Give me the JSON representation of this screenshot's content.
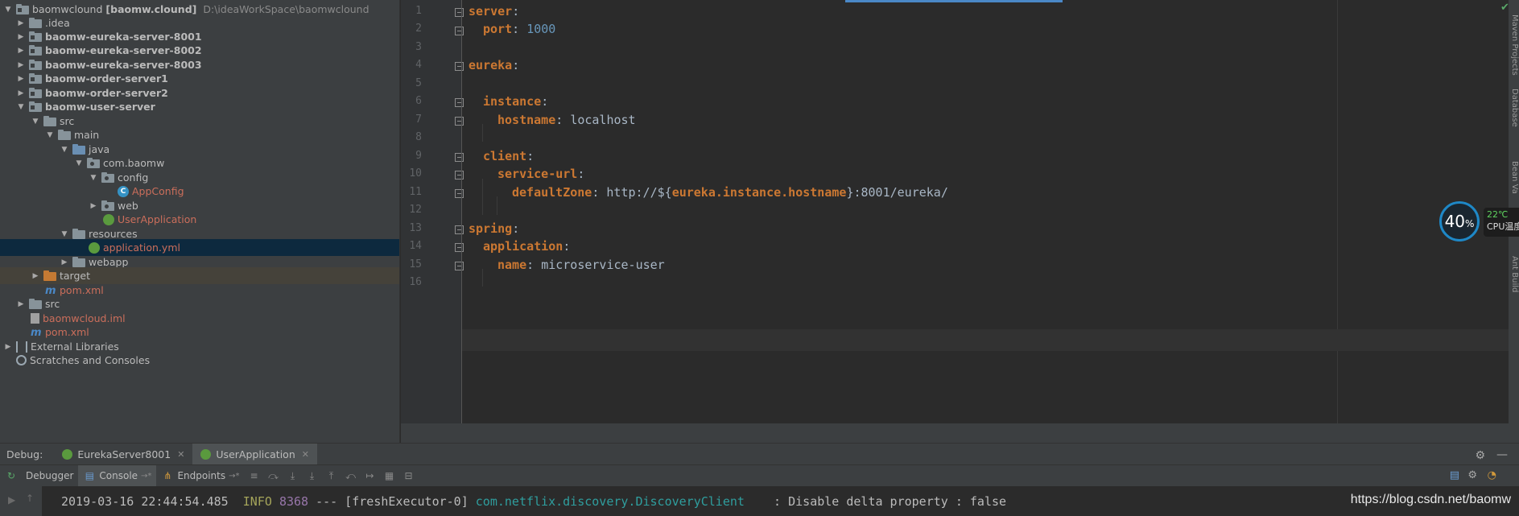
{
  "tree": {
    "root_name": "baomwclound",
    "root_module": "[baomw.clound]",
    "root_path": "D:\\ideaWorkSpace\\baomwclound",
    "items": [
      {
        "label": "baomwclound",
        "depth": 0
      },
      {
        "label": ".idea"
      },
      {
        "label": "baomw-eureka-server-8001"
      },
      {
        "label": "baomw-eureka-server-8002"
      },
      {
        "label": "baomw-eureka-server-8003"
      },
      {
        "label": "baomw-order-server1"
      },
      {
        "label": "baomw-order-server2"
      },
      {
        "label": "baomw-user-server"
      },
      {
        "label": "src"
      },
      {
        "label": "main"
      },
      {
        "label": "java"
      },
      {
        "label": "com.baomw"
      },
      {
        "label": "config"
      },
      {
        "label": "AppConfig"
      },
      {
        "label": "web"
      },
      {
        "label": "UserApplication"
      },
      {
        "label": "resources"
      },
      {
        "label": "application.yml"
      },
      {
        "label": "webapp"
      },
      {
        "label": "target"
      },
      {
        "label": "pom.xml"
      },
      {
        "label": "src"
      },
      {
        "label": "baomwcloud.iml"
      },
      {
        "label": "pom.xml"
      },
      {
        "label": "External Libraries"
      },
      {
        "label": "Scratches and Consoles"
      }
    ]
  },
  "editor": {
    "line_numbers": [
      "1",
      "2",
      "3",
      "4",
      "5",
      "6",
      "7",
      "8",
      "9",
      "10",
      "11",
      "12",
      "13",
      "14",
      "15",
      "16"
    ],
    "yaml": {
      "server": "server",
      "port_key": "port",
      "port_val": "1000",
      "eureka": "eureka",
      "instance": "instance",
      "hostname_key": "hostname",
      "hostname_val": "localhost",
      "client": "client",
      "service_url": "service-url",
      "default_zone_key": "defaultZone",
      "default_zone_prefix": "http://${",
      "default_zone_ref": "eureka.instance.hostname",
      "default_zone_suffix": "}:8001/eureka/",
      "spring": "spring",
      "application": "application",
      "name_key": "name",
      "name_val": "microservice-user",
      "colon": ":"
    }
  },
  "side_stripe": {
    "maven": "Maven Projects",
    "database": "Database",
    "bean": "Bean Va",
    "ant": "Ant Build"
  },
  "cpu": {
    "percent": "40",
    "unit": "%",
    "temp": "22℃",
    "label": "CPU温度"
  },
  "debug": {
    "label": "Debug:",
    "tabs": [
      "EurekaServer8001",
      "UserApplication"
    ],
    "toolbar_tabs": [
      "Debugger",
      "Console",
      "Endpoints"
    ],
    "pin_mark": "→*"
  },
  "console": {
    "timestamp": "2019-03-16 22:44:54.485",
    "level": "INFO",
    "pid": "8368",
    "sep": "---",
    "thread": "[freshExecutor-0]",
    "logger": "com.netflix.discovery.DiscoveryClient",
    "message": ": Disable delta property : false",
    "watermark": "https://blog.csdn.net/baomw"
  },
  "colors": {
    "keyword": "#cc7832",
    "number": "#6897bb",
    "selection": "#0d293e",
    "accent": "#4a88c7"
  }
}
